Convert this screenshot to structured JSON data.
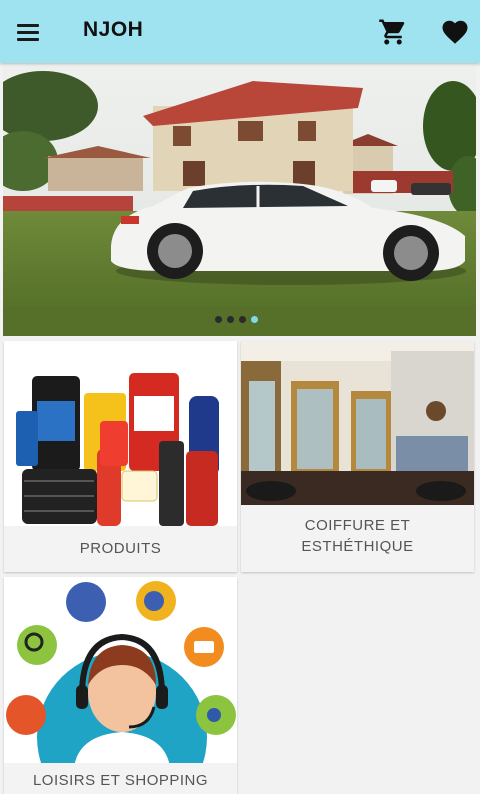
{
  "app": {
    "title": "NJOH"
  },
  "carousel": {
    "slide_count": 4,
    "active_index": 3
  },
  "categories": [
    {
      "label": "PRODUITS"
    },
    {
      "label_line1": "COIFFURE ET",
      "label_line2": "ESTHÉTHIQUE"
    },
    {
      "label": "LOISIRS ET SHOPPING"
    }
  ]
}
